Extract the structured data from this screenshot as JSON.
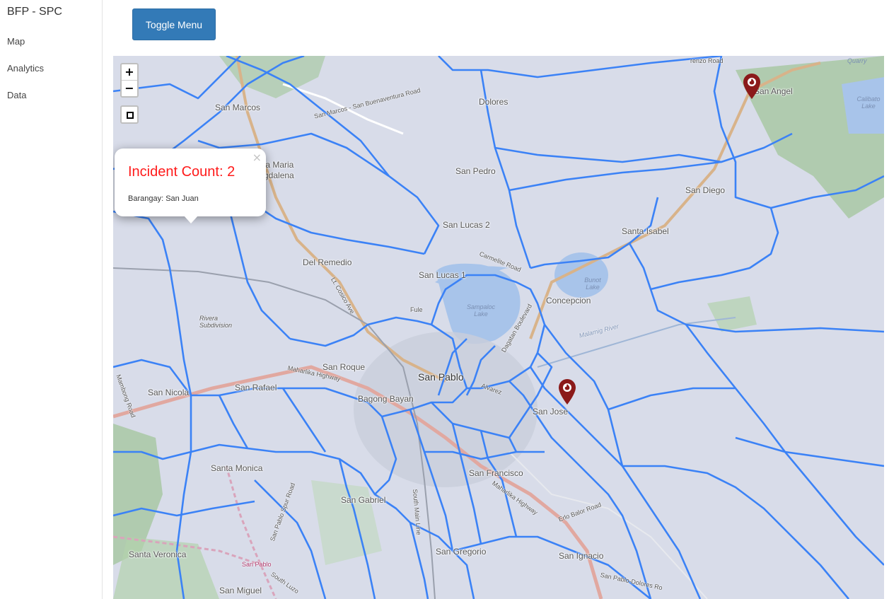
{
  "app": {
    "brand": "BFP - SPC"
  },
  "nav": {
    "items": [
      {
        "label": "Map"
      },
      {
        "label": "Analytics"
      },
      {
        "label": "Data"
      }
    ]
  },
  "toolbar": {
    "toggle_label": "Toggle Menu"
  },
  "map_controls": {
    "zoom_in": "+",
    "zoom_out": "−"
  },
  "popup": {
    "close": "×",
    "title": "Incident Count: 2",
    "subtitle": "Barangay: San Juan"
  },
  "markers": [
    {
      "icon": "fire-marker-icon"
    },
    {
      "icon": "fire-marker-icon"
    }
  ],
  "map_labels": {
    "san_marcos": "San Marcos",
    "dolores": "Dolores",
    "san_angel": "San Angel",
    "sta_maria": "ta Maria",
    "magdalena": "gdalena",
    "san_pedro": "San Pedro",
    "san_diego": "San Diego",
    "san_lucas_2": "San Lucas 2",
    "santa_isabel": "Santa Isabel",
    "del_remedio": "Del Remedio",
    "san_lucas_1": "San Lucas 1",
    "concepcion": "Concepcion",
    "san_roque": "San Roque",
    "san_pablo": "San Pablo",
    "san_nicolas": "San Nicola",
    "san_rafael": "San Rafael",
    "bagong_bayan": "Bagong Bayan",
    "san_jose": "San Jose",
    "santa_monica": "Santa Monica",
    "san_francisco": "San Francisco",
    "san_gabriel": "San Gabriel",
    "san_gregorio": "San Gregorio",
    "san_ignacio": "San Ignacio",
    "santa_veronica": "Santa Veronica",
    "san_miguel": "San Miguel",
    "rivera": "Rivera Subdivision"
  },
  "water_labels": {
    "sampaloc": "Sampaloc Lake",
    "bunot": "Bunot Lake",
    "calibato": "Calibato Lake",
    "quarry": "Quarry"
  },
  "road_labels": {
    "marcos_road": "San Marcos - San Buenaventura Road",
    "carmelite": "Carmelite Road",
    "dagatan": "Dagatan Boulevard",
    "maharlika_w": "Maharlika Highway",
    "maharlika_e": "Maharlika Highway",
    "malamig": "Malamig River",
    "lt_cosico": "Lt. Cosico Ave",
    "south_main": "South Main Line",
    "fule": "Fule",
    "alvarez": "Alvarez",
    "balor": "Erlo Balor Road",
    "dolores_road": "San Pablo-Dolores Ro",
    "lorenzo": "renzo Road",
    "mambong": "Mambong Road",
    "spur": "San Pablo Spur Road",
    "south_luzon": "South Luzo",
    "sp_station": "San Pablo"
  },
  "colors": {
    "accent": "#337ab7",
    "boundary": "#3b82f6",
    "popup_title": "#ff1a1a",
    "marker": "#8b1a1a"
  }
}
